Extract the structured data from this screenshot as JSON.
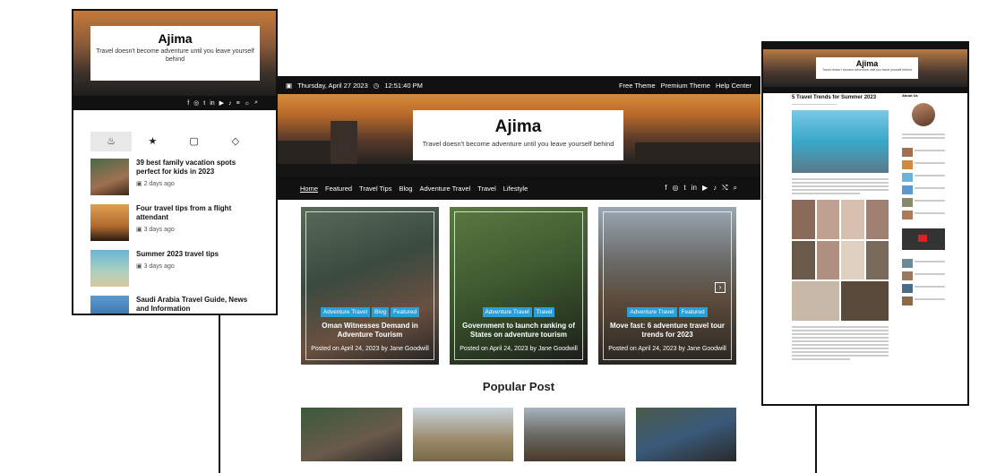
{
  "main": {
    "topbar": {
      "date": "Thursday, April 27 2023",
      "time": "12:51:40 PM",
      "links": [
        "Free Theme",
        "Premium Theme",
        "Help Center"
      ]
    },
    "hero": {
      "title": "Ajima",
      "tagline": "Travel doesn't become adventure until you leave yourself behind"
    },
    "nav": [
      "Home",
      "Featured",
      "Travel Tips",
      "Blog",
      "Adventure Travel",
      "Travel",
      "Lifestyle"
    ],
    "cards": [
      {
        "tags": [
          "Adventure Travel",
          "Blog",
          "Featured"
        ],
        "title": "Oman Witnesses Demand in Adventure Tourism",
        "meta": "Posted on April 24, 2023 by Jane Goodwill"
      },
      {
        "tags": [
          "Adventure Travel",
          "Travel"
        ],
        "title": "Government to launch ranking of States on adventure tourism",
        "meta": "Posted on April 24, 2023 by Jane Goodwill"
      },
      {
        "tags": [
          "Adventure Travel",
          "Featured"
        ],
        "title": "Move fast: 6 adventure travel tour trends for 2023",
        "meta": "Posted on April 24, 2023 by Jane Goodwill"
      }
    ],
    "popular_title": "Popular Post"
  },
  "mobile": {
    "hero": {
      "title": "Ajima",
      "tagline": "Travel doesn't become adventure until you leave yourself behind"
    },
    "items": [
      {
        "title": "39 best family vacation spots perfect for kids in 2023",
        "date": "2 days ago"
      },
      {
        "title": "Four travel tips from a flight attendant",
        "date": "3 days ago"
      },
      {
        "title": "Summer 2023 travel tips",
        "date": "3 days ago"
      },
      {
        "title": "Saudi Arabia Travel Guide, News and Information",
        "date": ""
      }
    ]
  },
  "right": {
    "title": "Ajima",
    "tagline": "Travel doesn't become adventure until you leave yourself behind",
    "post_title": "5 Travel Trends for Summer 2023",
    "about": "About Us"
  },
  "colors": {
    "tag": "#2a9fd8",
    "dark": "#111111"
  }
}
